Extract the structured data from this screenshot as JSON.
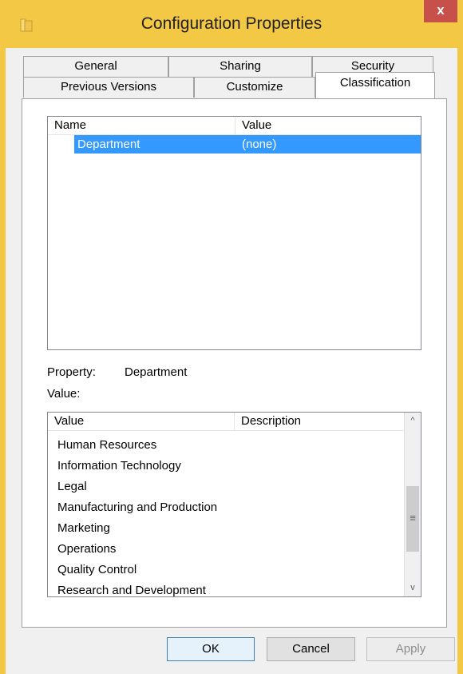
{
  "window": {
    "title": "Configuration Properties",
    "close_glyph": "x",
    "icon": "folder-icon"
  },
  "tabs": {
    "row_back": [
      {
        "label": "General"
      },
      {
        "label": "Sharing"
      },
      {
        "label": "Security"
      }
    ],
    "row_front": [
      {
        "label": "Previous Versions"
      },
      {
        "label": "Customize"
      },
      {
        "label": "Classification",
        "active": true
      }
    ]
  },
  "properties_list": {
    "columns": {
      "name": "Name",
      "value": "Value"
    },
    "rows": [
      {
        "name": "Department",
        "value": "(none)",
        "selected": true
      }
    ]
  },
  "property_info": {
    "property_label": "Property:",
    "property_value": "Department",
    "value_label": "Value:"
  },
  "values_list": {
    "columns": {
      "value": "Value",
      "description": "Description"
    },
    "items": [
      "Human Resources",
      "Information Technology",
      "Legal",
      "Manufacturing and Production",
      "Marketing",
      "Operations",
      "Quality Control",
      "Research and Development"
    ],
    "scroll_up_glyph": "^",
    "scroll_down_glyph": "v",
    "thumb_glyph": "≡"
  },
  "buttons": {
    "ok": "OK",
    "cancel": "Cancel",
    "apply": "Apply"
  },
  "colors": {
    "titlebar": "#f3c844",
    "close": "#c7504b",
    "selection": "#3399ff"
  }
}
